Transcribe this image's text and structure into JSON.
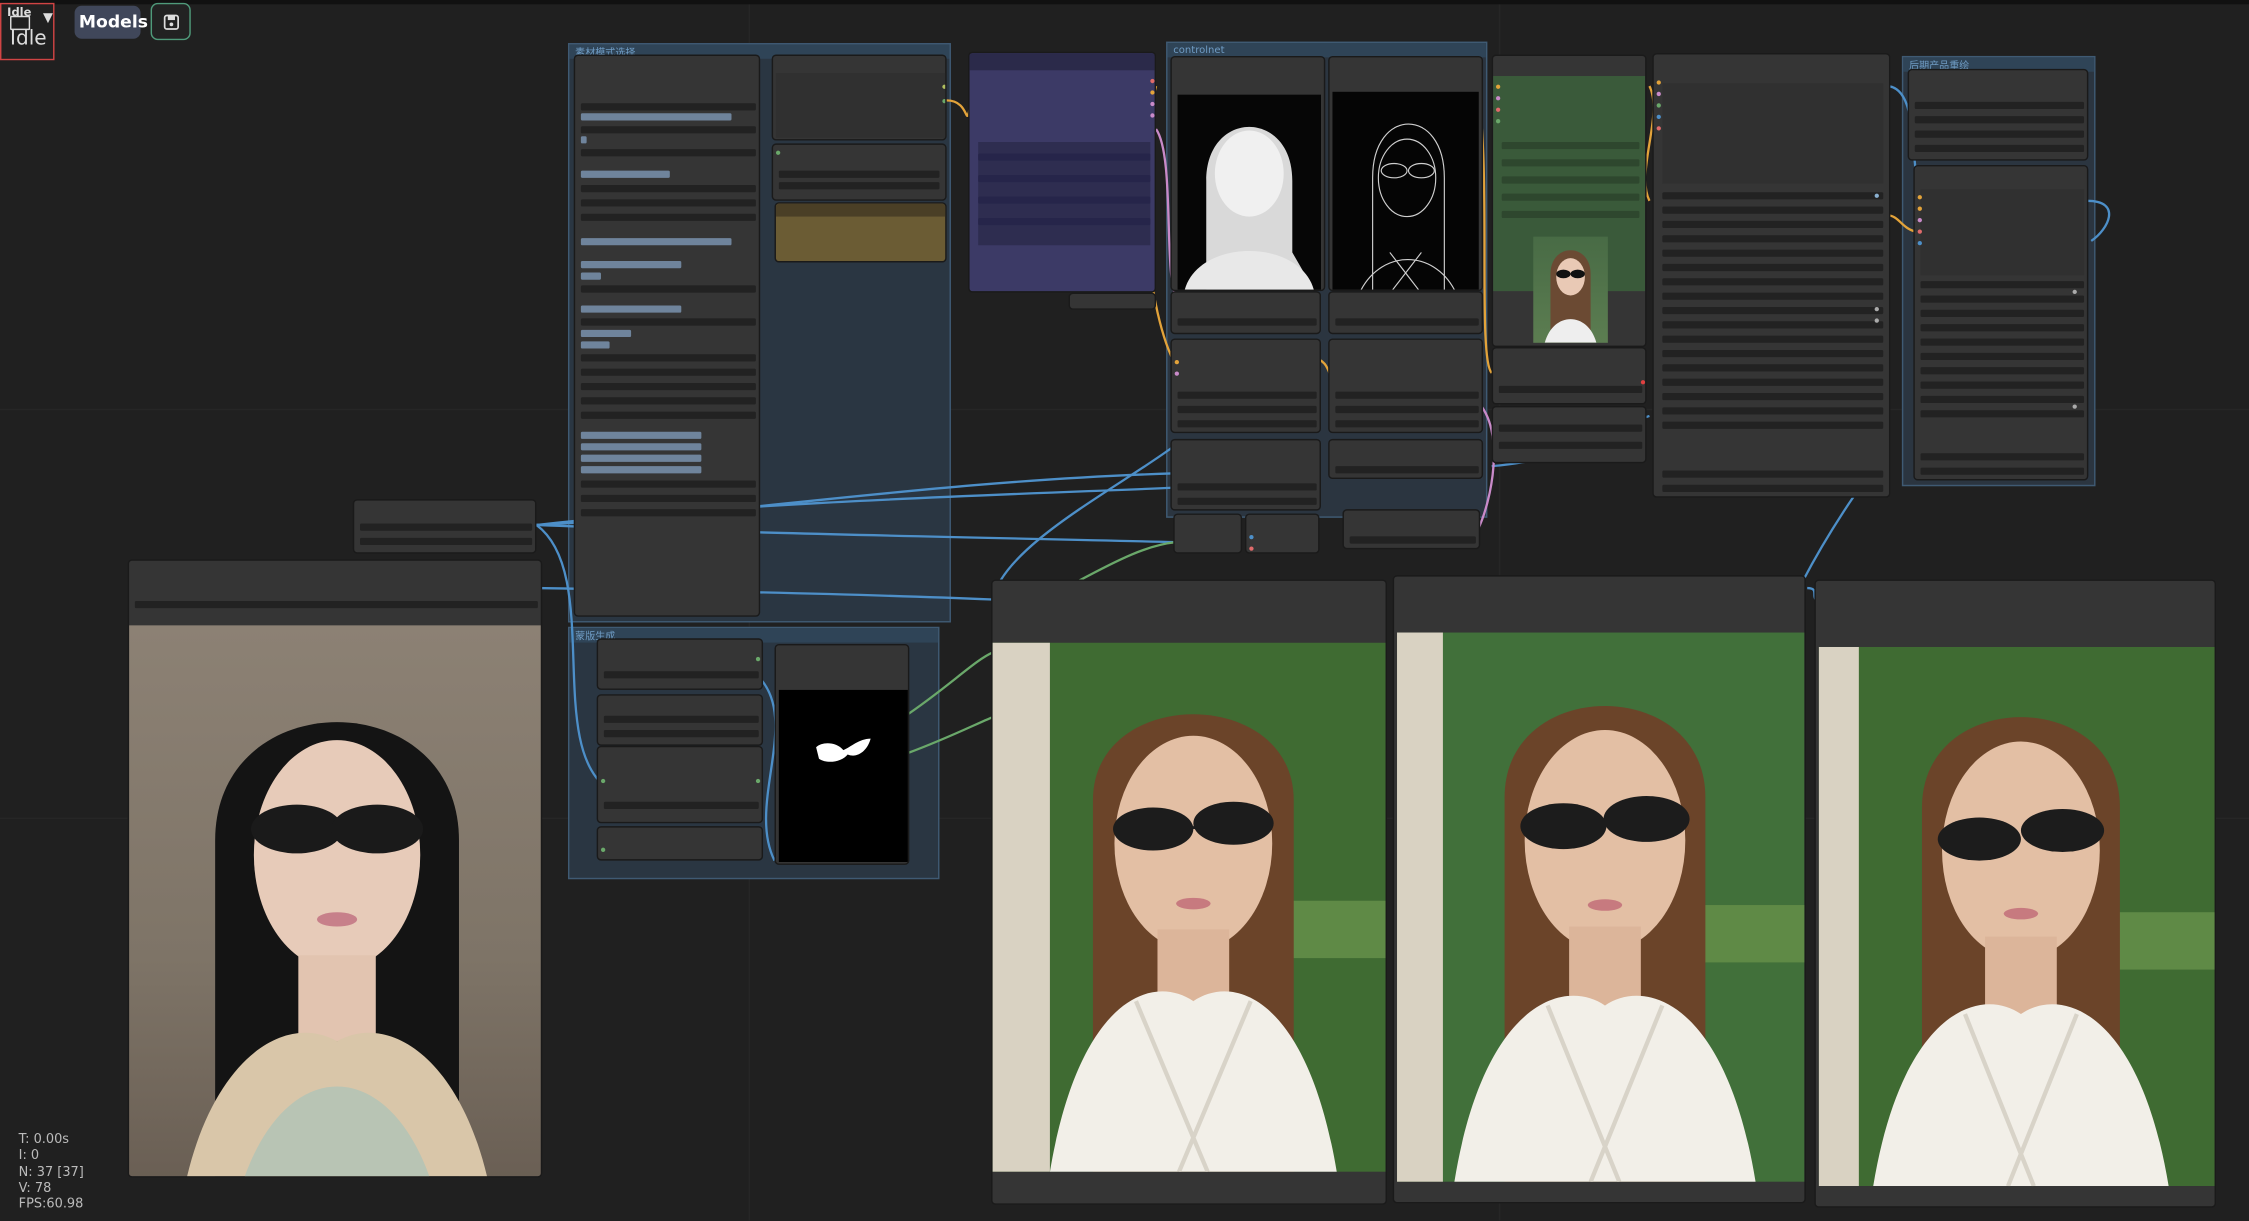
{
  "topbar": {
    "status_text": "Idle",
    "queue_label": "Idle",
    "models_label": "Models"
  },
  "groups": [
    {
      "title": "素材模式选择"
    },
    {
      "title": "蒙版生成"
    },
    {
      "title": "controlnet"
    },
    {
      "title": "后期产品重绘"
    }
  ],
  "stats": {
    "time": "T: 0.00s",
    "index": "I: 0",
    "nodes": "N: 37 [37]",
    "vertices": "V: 78",
    "fps": "FPS:60.98"
  },
  "colors": {
    "canvas_bg": "#202020",
    "node_bg": "#353535",
    "group_blue": "#3f5a73",
    "wire_blue": "#4d8fc8",
    "wire_orange": "#e3a33a",
    "wire_green": "#6aa86a",
    "wire_pink": "#c98ac9",
    "node_purple": "#3c3a66",
    "node_green": "#3a5a3a",
    "node_olive": "#6b5c34",
    "save_button_border": "#4f9a7a"
  },
  "icons": {
    "queue": "layout-icon",
    "dropdown": "chevron-down-icon",
    "save": "save-icon"
  }
}
